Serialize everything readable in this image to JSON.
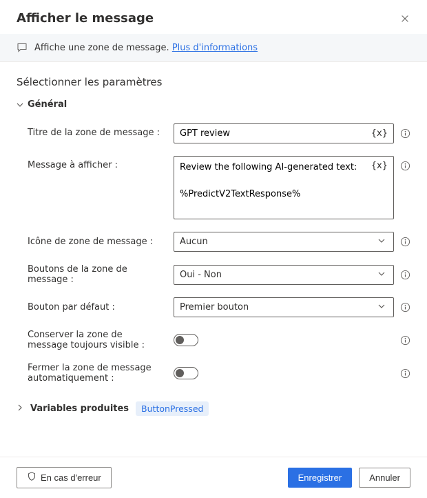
{
  "header": {
    "title": "Afficher le message"
  },
  "info": {
    "text": "Affiche une zone de message.",
    "link": "Plus d'informations"
  },
  "section": {
    "title": "Sélectionner les paramètres"
  },
  "general": {
    "label": "Général"
  },
  "fields": {
    "title_label": "Titre de la zone de message :",
    "title_value": "GPT review",
    "message_label": "Message à afficher :",
    "message_value": "Review the following AI-generated text:\n\n%PredictV2TextResponse%",
    "icon_label": "Icône de zone de message :",
    "icon_value": "Aucun",
    "buttons_label": "Boutons de la zone de message :",
    "buttons_value": "Oui - Non",
    "default_btn_label": "Bouton par défaut :",
    "default_btn_value": "Premier bouton",
    "always_top_label": "Conserver la zone de message toujours visible :",
    "auto_close_label": "Fermer la zone de message automatiquement :",
    "var_token": "{x}"
  },
  "vars": {
    "label": "Variables produites",
    "chip": "ButtonPressed"
  },
  "footer": {
    "error": "En cas d'erreur",
    "save": "Enregistrer",
    "cancel": "Annuler"
  }
}
